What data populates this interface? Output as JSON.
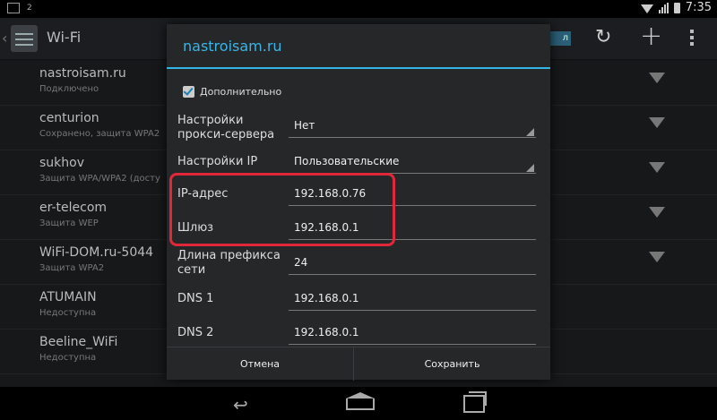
{
  "status_bar": {
    "notification_count": "2",
    "time": "7:35"
  },
  "action_bar": {
    "title": "Wi-Fi",
    "switch_label": "л"
  },
  "networks": [
    {
      "name": "nastroisam.ru",
      "status": "Подключено"
    },
    {
      "name": "centurion",
      "status": "Сохранено, защита WPA2"
    },
    {
      "name": "sukhov",
      "status": "Защита WPA/WPA2 (досту"
    },
    {
      "name": "er-telecom",
      "status": "Защита WEP"
    },
    {
      "name": "WiFi-DOM.ru-5044",
      "status": "Защита WPA2"
    },
    {
      "name": "ATUMAIN",
      "status": "Недоступна"
    },
    {
      "name": "Beeline_WiFi",
      "status": "Недоступна"
    }
  ],
  "dialog": {
    "title": "nastroisam.ru",
    "advanced_label": "Дополнительно",
    "advanced_checked": true,
    "proxy_label": "Настройки прокси-сервера",
    "proxy_value": "Нет",
    "ip_settings_label": "Настройки IP",
    "ip_settings_value": "Пользовательские",
    "ip_label": "IP-адрес",
    "ip_value": "192.168.0.76",
    "gateway_label": "Шлюз",
    "gateway_value": "192.168.0.1",
    "prefix_label": "Длина префикса сети",
    "prefix_value": "24",
    "dns1_label": "DNS 1",
    "dns1_value": "192.168.0.1",
    "dns2_label": "DNS 2",
    "dns2_value": "192.168.0.1",
    "cancel_label": "Отмена",
    "save_label": "Сохранить"
  },
  "colors": {
    "accent": "#33b5e5",
    "highlight": "#e0283a"
  }
}
